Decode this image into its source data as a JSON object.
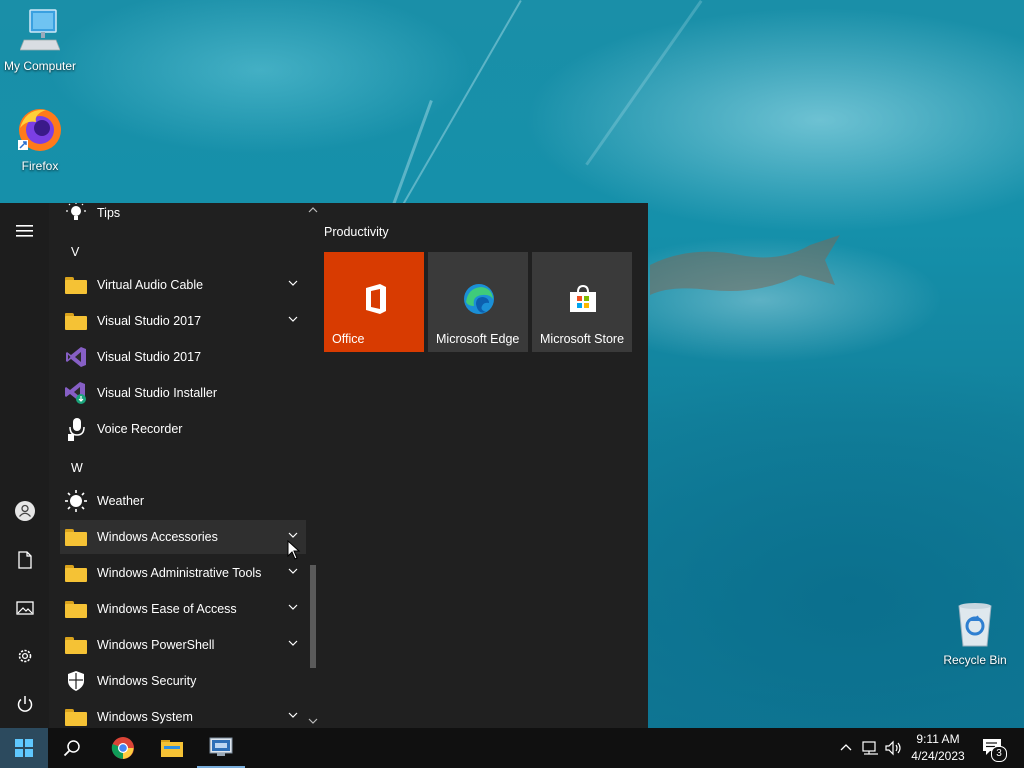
{
  "desktop": {
    "icons": [
      {
        "label": "My Computer",
        "icon": "computer-icon"
      },
      {
        "label": "Firefox",
        "icon": "firefox-icon"
      },
      {
        "label": "Recycle Bin",
        "icon": "recycle-bin-icon"
      }
    ]
  },
  "start_menu": {
    "rail": {
      "icons": [
        "hamburger-menu-icon",
        "user-account-icon",
        "documents-icon",
        "pictures-icon",
        "settings-icon",
        "power-icon"
      ]
    },
    "apps": [
      {
        "label": "Tips",
        "kind": "app",
        "icon": "lightbulb-icon"
      },
      {
        "label": "V",
        "kind": "letter"
      },
      {
        "label": "Virtual Audio Cable",
        "kind": "folder",
        "icon": "folder-icon"
      },
      {
        "label": "Visual Studio 2017",
        "kind": "folder",
        "icon": "folder-icon"
      },
      {
        "label": "Visual Studio 2017",
        "kind": "app",
        "icon": "visual-studio-icon"
      },
      {
        "label": "Visual Studio Installer",
        "kind": "app",
        "icon": "visual-studio-installer-icon"
      },
      {
        "label": "Voice Recorder",
        "kind": "app",
        "icon": "microphone-icon"
      },
      {
        "label": "W",
        "kind": "letter"
      },
      {
        "label": "Weather",
        "kind": "app",
        "icon": "sun-icon"
      },
      {
        "label": "Windows Accessories",
        "kind": "folder",
        "icon": "folder-icon",
        "highlighted": true
      },
      {
        "label": "Windows Administrative Tools",
        "kind": "folder",
        "icon": "folder-icon"
      },
      {
        "label": "Windows Ease of Access",
        "kind": "folder",
        "icon": "folder-icon"
      },
      {
        "label": "Windows PowerShell",
        "kind": "folder",
        "icon": "folder-icon"
      },
      {
        "label": "Windows Security",
        "kind": "app",
        "icon": "shield-icon"
      },
      {
        "label": "Windows System",
        "kind": "folder",
        "icon": "folder-icon"
      }
    ],
    "tile_group": {
      "title": "Productivity",
      "tiles": [
        {
          "label": "Office",
          "icon": "office-icon",
          "color": "#d83b01"
        },
        {
          "label": "Microsoft Edge",
          "icon": "edge-icon",
          "color": "#3a3a3a"
        },
        {
          "label": "Microsoft Store",
          "icon": "store-icon",
          "color": "#3a3a3a"
        }
      ]
    }
  },
  "taskbar": {
    "pinned": [
      "windows-start-icon",
      "search-icon",
      "chrome-icon",
      "file-explorer-icon",
      "remote-desktop-icon"
    ],
    "tray": {
      "time": "9:11 AM",
      "date": "4/24/2023",
      "notification_count": "3"
    }
  },
  "colors": {
    "start_bg": "#202020",
    "highlight": "#2f2f2f",
    "office_tile": "#d83b01",
    "taskbar": "#101010"
  }
}
